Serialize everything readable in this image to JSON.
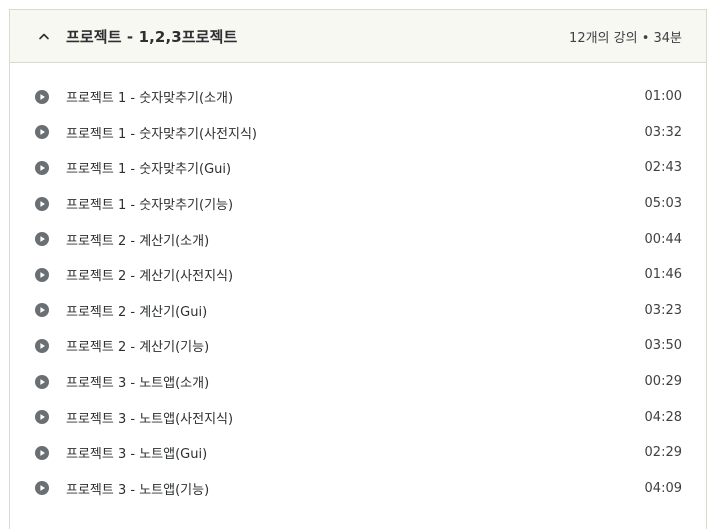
{
  "section": {
    "title": "프로젝트 - 1,2,3프로젝트",
    "meta": "12개의 강의 • 34분",
    "icon": "chevron-up-icon"
  },
  "lectures": [
    {
      "title": "프로젝트 1 - 숫자맞추기(소개)",
      "duration": "01:00"
    },
    {
      "title": "프로젝트 1 - 숫자맞추기(사전지식)",
      "duration": "03:32"
    },
    {
      "title": "프로젝트 1 - 숫자맞추기(Gui)",
      "duration": "02:43"
    },
    {
      "title": "프로젝트 1 - 숫자맞추기(기능)",
      "duration": "05:03"
    },
    {
      "title": "프로젝트 2 - 계산기(소개)",
      "duration": "00:44"
    },
    {
      "title": "프로젝트 2 - 계산기(사전지식)",
      "duration": "01:46"
    },
    {
      "title": "프로젝트 2 - 계산기(Gui)",
      "duration": "03:23"
    },
    {
      "title": "프로젝트 2 - 계산기(기능)",
      "duration": "03:50"
    },
    {
      "title": "프로젝트 3 - 노트앱(소개)",
      "duration": "00:29"
    },
    {
      "title": "프로젝트 3 - 노트앱(사전지식)",
      "duration": "04:28"
    },
    {
      "title": "프로젝트 3 - 노트앱(Gui)",
      "duration": "02:29"
    },
    {
      "title": "프로젝트 3 - 노트앱(기능)",
      "duration": "04:09"
    }
  ],
  "lecture_icon": "play-circle-icon",
  "colors": {
    "header_bg": "#f8f8f3",
    "border": "#d9d9d0",
    "icon": "#6a6f73",
    "text": "#2d2f31"
  }
}
